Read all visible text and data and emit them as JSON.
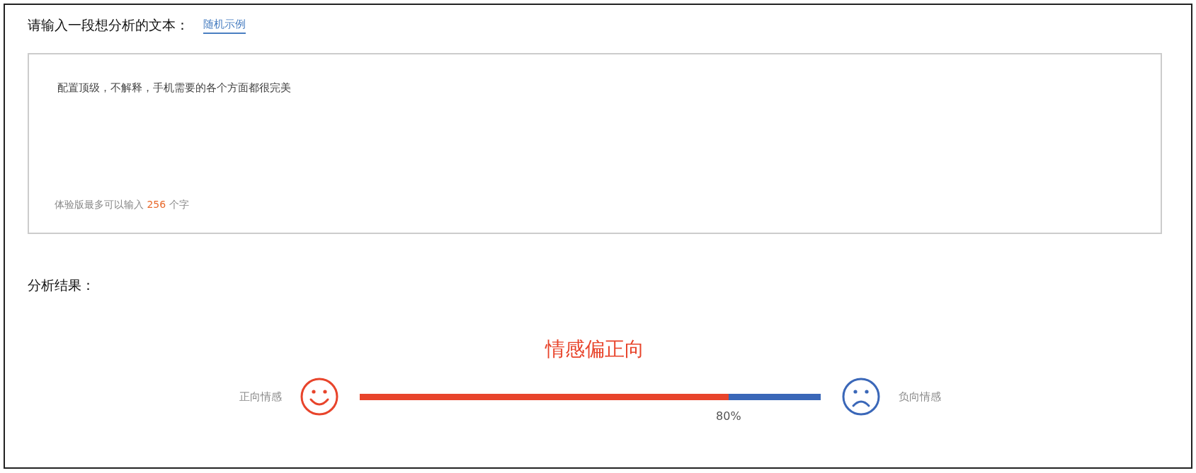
{
  "input_section": {
    "heading": "请输入一段想分析的文本：",
    "random_example_link": "随机示例"
  },
  "text_area": {
    "value": "配置顶级，不解释，手机需要的各个方面都很完美",
    "hint_before": "体验版最多可以输入",
    "hint_count": "256",
    "hint_after": "个字"
  },
  "result_section": {
    "heading": "分析结果：",
    "verdict": "情感偏正向",
    "positive_label": "正向情感",
    "negative_label": "负向情感",
    "level": 0.8,
    "percent": "80%"
  }
}
